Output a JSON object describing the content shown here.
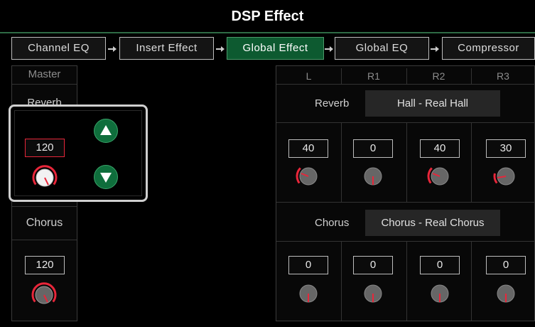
{
  "header": {
    "title": "DSP Effect"
  },
  "tabs": [
    {
      "label": "Channel EQ",
      "active": false
    },
    {
      "label": "Insert Effect",
      "active": false
    },
    {
      "label": "Global Effect",
      "active": true
    },
    {
      "label": "Global EQ",
      "active": false
    },
    {
      "label": "Compressor",
      "active": false
    }
  ],
  "master": {
    "header": "Master",
    "reverb_label": "Reverb",
    "reverb_value": "120",
    "chorus_label": "Chorus",
    "chorus_value": "120"
  },
  "popup": {
    "value": "120",
    "up_icon": "arrow-up-icon",
    "down_icon": "arrow-down-icon"
  },
  "channels": {
    "headers": [
      "L",
      "R1",
      "R2",
      "R3"
    ],
    "reverb_label": "Reverb",
    "reverb_type": "Hall - Real Hall",
    "reverb_values": [
      "40",
      "0",
      "40",
      "30"
    ],
    "chorus_label": "Chorus",
    "chorus_type": "Chorus - Real Chorus",
    "chorus_values": [
      "0",
      "0",
      "0",
      "0"
    ]
  },
  "colors": {
    "accent_green": "#0d5a30",
    "knob_red": "#e8263a"
  }
}
